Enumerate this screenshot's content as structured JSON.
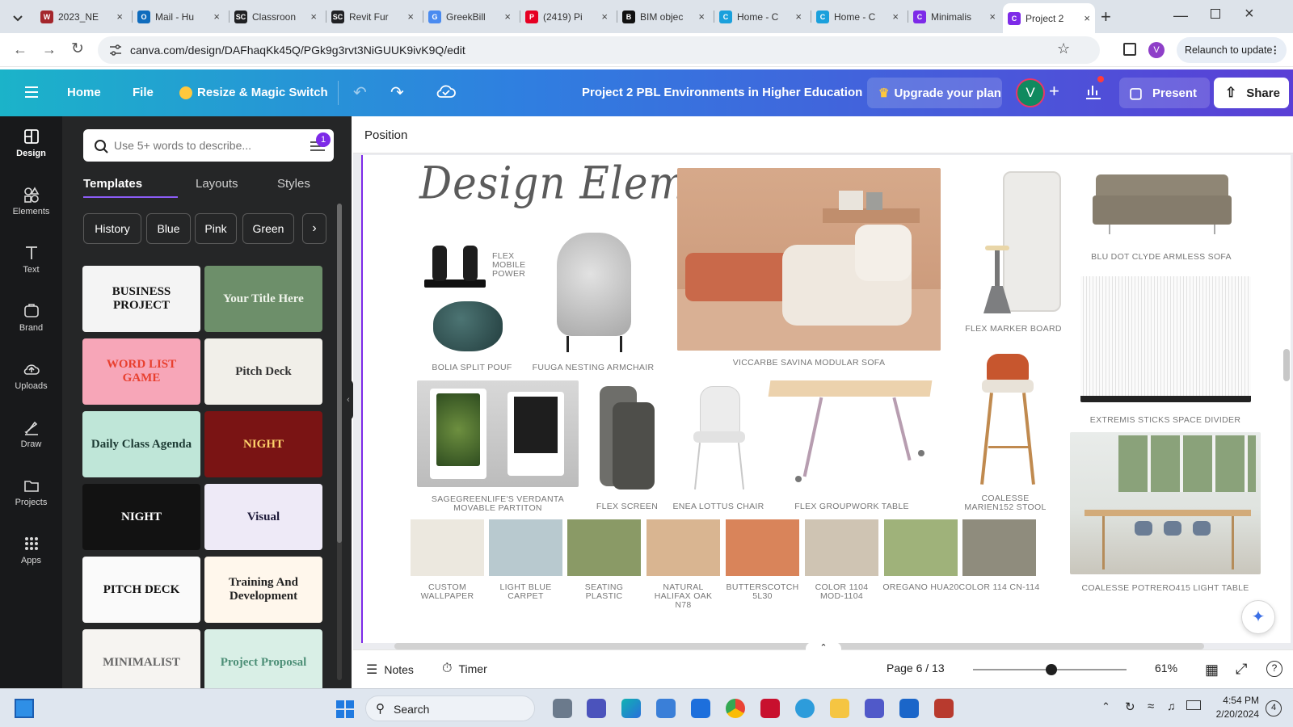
{
  "browser": {
    "tabs": [
      {
        "title": "2023_NE",
        "color": "#a4262c",
        "glyph": "W"
      },
      {
        "title": "Mail - Hu",
        "color": "#0f6cbd",
        "glyph": "O"
      },
      {
        "title": "Classroon",
        "color": "#202124",
        "glyph": "SC"
      },
      {
        "title": "Revit Fur",
        "color": "#202124",
        "glyph": "SC"
      },
      {
        "title": "GreekBill",
        "color": "#4a8bf0",
        "glyph": "G"
      },
      {
        "title": "(2419) Pi",
        "color": "#e60023",
        "glyph": "P"
      },
      {
        "title": "BIM objec",
        "color": "#111111",
        "glyph": "B"
      },
      {
        "title": "Home - C",
        "color": "#1aa0dc",
        "glyph": "C"
      },
      {
        "title": "Home - C",
        "color": "#1aa0dc",
        "glyph": "C"
      },
      {
        "title": "Minimalis",
        "color": "#7d2ae8",
        "glyph": "C"
      },
      {
        "title": "Project 2",
        "color": "#7d2ae8",
        "glyph": "C"
      }
    ],
    "active_tab_index": 10,
    "url": "canva.com/design/DAFhaqKk45Q/PGk9g3rvt3NiGUUK9ivK9Q/edit",
    "profile_initial": "V",
    "relaunch_label": "Relaunch to update"
  },
  "canva_header": {
    "home": "Home",
    "file": "File",
    "resize": "Resize & Magic Switch",
    "doc_title": "Project 2 PBL Environments in Higher Education",
    "upgrade": "Upgrade your plan",
    "avatar_initial": "V",
    "present": "Present",
    "share": "Share"
  },
  "rail": [
    {
      "label": "Design",
      "icon": "design-icon"
    },
    {
      "label": "Elements",
      "icon": "elements-icon"
    },
    {
      "label": "Text",
      "icon": "text-icon"
    },
    {
      "label": "Brand",
      "icon": "brand-icon"
    },
    {
      "label": "Uploads",
      "icon": "uploads-icon"
    },
    {
      "label": "Draw",
      "icon": "draw-icon"
    },
    {
      "label": "Projects",
      "icon": "projects-icon"
    },
    {
      "label": "Apps",
      "icon": "apps-icon"
    }
  ],
  "panel": {
    "search_placeholder": "Use 5+ words to describe...",
    "filter_badge": "1",
    "tabs": [
      "Templates",
      "Layouts",
      "Styles"
    ],
    "chips": [
      "History",
      "Blue",
      "Pink",
      "Green"
    ],
    "templates": [
      {
        "text": "BUSINESS PROJECT",
        "bg": "#f4f4f4",
        "fg": "#111111"
      },
      {
        "text": "Your Title Here",
        "bg": "#6d8f6a",
        "fg": "#eef3ea"
      },
      {
        "text": "WORD LIST GAME",
        "bg": "#f7a6b8",
        "fg": "#e8402f"
      },
      {
        "text": "Pitch Deck",
        "bg": "#f1efe9",
        "fg": "#333333"
      },
      {
        "text": "Daily Class Agenda",
        "bg": "#bfe6d8",
        "fg": "#1d3b34"
      },
      {
        "text": "NIGHT",
        "bg": "#7a1414",
        "fg": "#ffd36b"
      },
      {
        "text": "NIGHT",
        "bg": "#121212",
        "fg": "#ffffff"
      },
      {
        "text": "Visual",
        "bg": "#eeeaf7",
        "fg": "#1e1b3a"
      },
      {
        "text": "PITCH DECK",
        "bg": "#fafafa",
        "fg": "#111111"
      },
      {
        "text": "Training And Development",
        "bg": "#fff7ec",
        "fg": "#222222"
      },
      {
        "text": "MINIMALIST",
        "bg": "#f6f4f1",
        "fg": "#666666"
      },
      {
        "text": "Project Proposal",
        "bg": "#d9efe6",
        "fg": "#4d8f77"
      }
    ]
  },
  "editor": {
    "toolbar_label": "Position",
    "page_title": "Design Elements",
    "captions": {
      "flex_power": "FLEX\nMOBILE\nPOWER",
      "bolia": "BOLIA SPLIT POUF",
      "fuuga": "FUUGA NESTING ARMCHAIR",
      "savina": "VICCARBE SAVINA MODULAR SOFA",
      "marker": "FLEX MARKER BOARD",
      "clyde": "BLU DOT CLYDE ARMLESS SOFA",
      "extremis": "EXTREMIS STICKS SPACE DIVIDER",
      "verdanta": "SAGEGREENLIFE'S VERDANTA\nMOVABLE PARTITON",
      "screen": "FLEX SCREEN",
      "lottus": "ENEA LOTTUS CHAIR",
      "groupwork": "FLEX GROUPWORK  TABLE",
      "stool": "COALESSE\nMARIEN152 STOOL",
      "potrero": "COALESSE POTRERO415 LIGHT TABLE"
    },
    "swatches": [
      {
        "label": "CUSTOM\nWALLPAPER",
        "color": "#ece8df"
      },
      {
        "label": "LIGHT BLUE\nCARPET",
        "color": "#b8c9cf"
      },
      {
        "label": "SEATING\nPLASTIC",
        "color": "#8a9a66"
      },
      {
        "label": "NATURAL\nHALIFAX OAK\nN78",
        "color": "#d9b591"
      },
      {
        "label": "BUTTERSCOTCH\n5L30",
        "color": "#d9845a"
      },
      {
        "label": "COLOR 1104\nMOD-1104",
        "color": "#cfc4b3"
      },
      {
        "label": "OREGANO HUA20",
        "color": "#9fb27a"
      },
      {
        "label": "COLOR 114 CN-114",
        "color": "#8f8c7d"
      }
    ]
  },
  "bottom_bar": {
    "notes": "Notes",
    "timer": "Timer",
    "page_indicator": "Page 6 / 13",
    "zoom": "61%",
    "zoom_fraction": 0.61
  },
  "taskbar": {
    "search": "Search",
    "time": "4:54 PM",
    "date": "2/20/2024",
    "notification_count": "4"
  }
}
